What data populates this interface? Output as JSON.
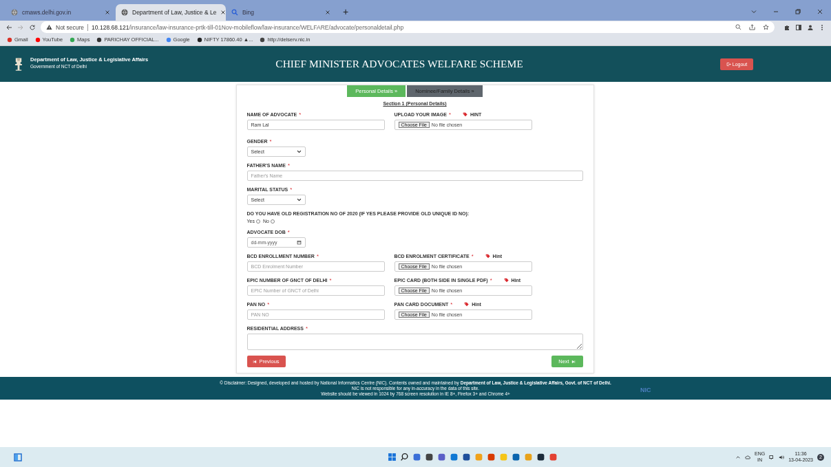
{
  "browser": {
    "tabs": [
      {
        "title": "cmaws.delhi.gov.in",
        "kind": "site",
        "selected": false
      },
      {
        "title": "Department of Law, Justice & Le",
        "kind": "site",
        "selected": true
      },
      {
        "title": "Bing",
        "kind": "search",
        "selected": false
      }
    ],
    "new_tab": "+",
    "address": {
      "security": "Not secure",
      "host": "10.128.68.121",
      "path": "/insurance/law-insurance-prtk-till-01Nov-mobileflow/law-insurance/WELFARE/advocate/personaldetail.php"
    },
    "bookmarks": [
      "Gmail",
      "YouTube",
      "Maps",
      "PARICHAY OFFICIAL...",
      "Google",
      "NIFTY 17860.40 ▲...",
      "http://delserv.nic.in"
    ]
  },
  "header": {
    "department": "Department of Law, Justice & Legislative Affairs",
    "government": "Government of NCT of Delhi",
    "title": "CHIEF MINISTER ADVOCATES WELFARE SCHEME",
    "logout": "Logout"
  },
  "form": {
    "steps": [
      {
        "label": "Personal Details »",
        "selected": true
      },
      {
        "label": "Nominee/Family Details »",
        "selected": false
      }
    ],
    "section": "Section 1 (Personal Details)",
    "rows": [
      [
        {
          "kind": "text",
          "label": "NAME OF ADVOCATE",
          "required_mark": "*",
          "value": "Ram Lal"
        },
        {
          "kind": "file",
          "label": "UPLOAD YOUR IMAGE",
          "required_mark": "*",
          "hint": "HINT",
          "button": "Choose File",
          "status": "No file chosen"
        }
      ],
      [
        {
          "kind": "select",
          "label": "GENDER",
          "required_mark": "*",
          "value": "Select"
        }
      ],
      [
        {
          "kind": "fulltext",
          "label": "FATHER'S NAME",
          "required_mark": "*",
          "placeholder": "Father's Name"
        }
      ],
      [
        {
          "kind": "select",
          "label": "MARITAL STATUS",
          "required_mark": "*",
          "value": "Select"
        }
      ],
      [
        {
          "kind": "radio",
          "label": "DO YOU HAVE OLD REGISTRATION NO OF 2020 (IF YES PLEASE PROVIDE OLD UNIQUE ID NO):",
          "options": [
            {
              "label": "Yes",
              "selected": false
            },
            {
              "label": "No",
              "selected": false
            }
          ]
        }
      ],
      [
        {
          "kind": "date",
          "label": "ADVOCATE DOB",
          "required_mark": "*",
          "placeholder": "dd-mm-yyyy"
        }
      ],
      [
        {
          "kind": "text",
          "label": "BCD ENROLLMENT NUMBER",
          "required_mark": "*",
          "placeholder": "BCD Enrolment Number"
        },
        {
          "kind": "file",
          "label": "BCD ENROLMENT CERTIFICATE",
          "required_mark": "*",
          "hint": "Hint",
          "button": "Choose File",
          "status": "No file chosen"
        }
      ],
      [
        {
          "kind": "text",
          "label": "EPIC NUMBER OF GNCT OF DELHI",
          "required_mark": "*",
          "placeholder": "EPIC Number of GNCT of Delhi"
        },
        {
          "kind": "file",
          "label": "EPIC CARD (BOTH SIDE IN SINGLE PDF)",
          "required_mark": "*",
          "hint": "Hint",
          "button": "Choose File",
          "status": "No file chosen"
        }
      ],
      [
        {
          "kind": "text",
          "label": "PAN NO",
          "required_mark": "*",
          "placeholder": "PAN NO"
        },
        {
          "kind": "file",
          "label": "PAN CARD DOCUMENT",
          "required_mark": "*",
          "hint": "Hint",
          "button": "Choose File",
          "status": "No file chosen"
        }
      ],
      [
        {
          "kind": "textarea",
          "label": "RESIDENTIAL ADDRESS",
          "required_mark": "*"
        }
      ]
    ],
    "previous": "Previous",
    "next": "Next"
  },
  "footer": {
    "lines": [
      "© Disclaimer: Designed, developed and hosted by National Informatics Centre (NIC). Contents owned and maintained by **Department of Law, Justice & Legislative Affairs, Govt. of NCT of Delhi.**",
      "NIC is not responsible for any in-accuracy in the data of this site.",
      "Website should be viewed in 1024 by 768 screen resolution in IE 8+, Firefox 3+ and Chrome 4+"
    ],
    "logo": "NIC"
  },
  "taskbar": {
    "language": "ENG",
    "region": "IN",
    "time": "11:36",
    "date": "13-04-2023",
    "notifications": "2"
  }
}
